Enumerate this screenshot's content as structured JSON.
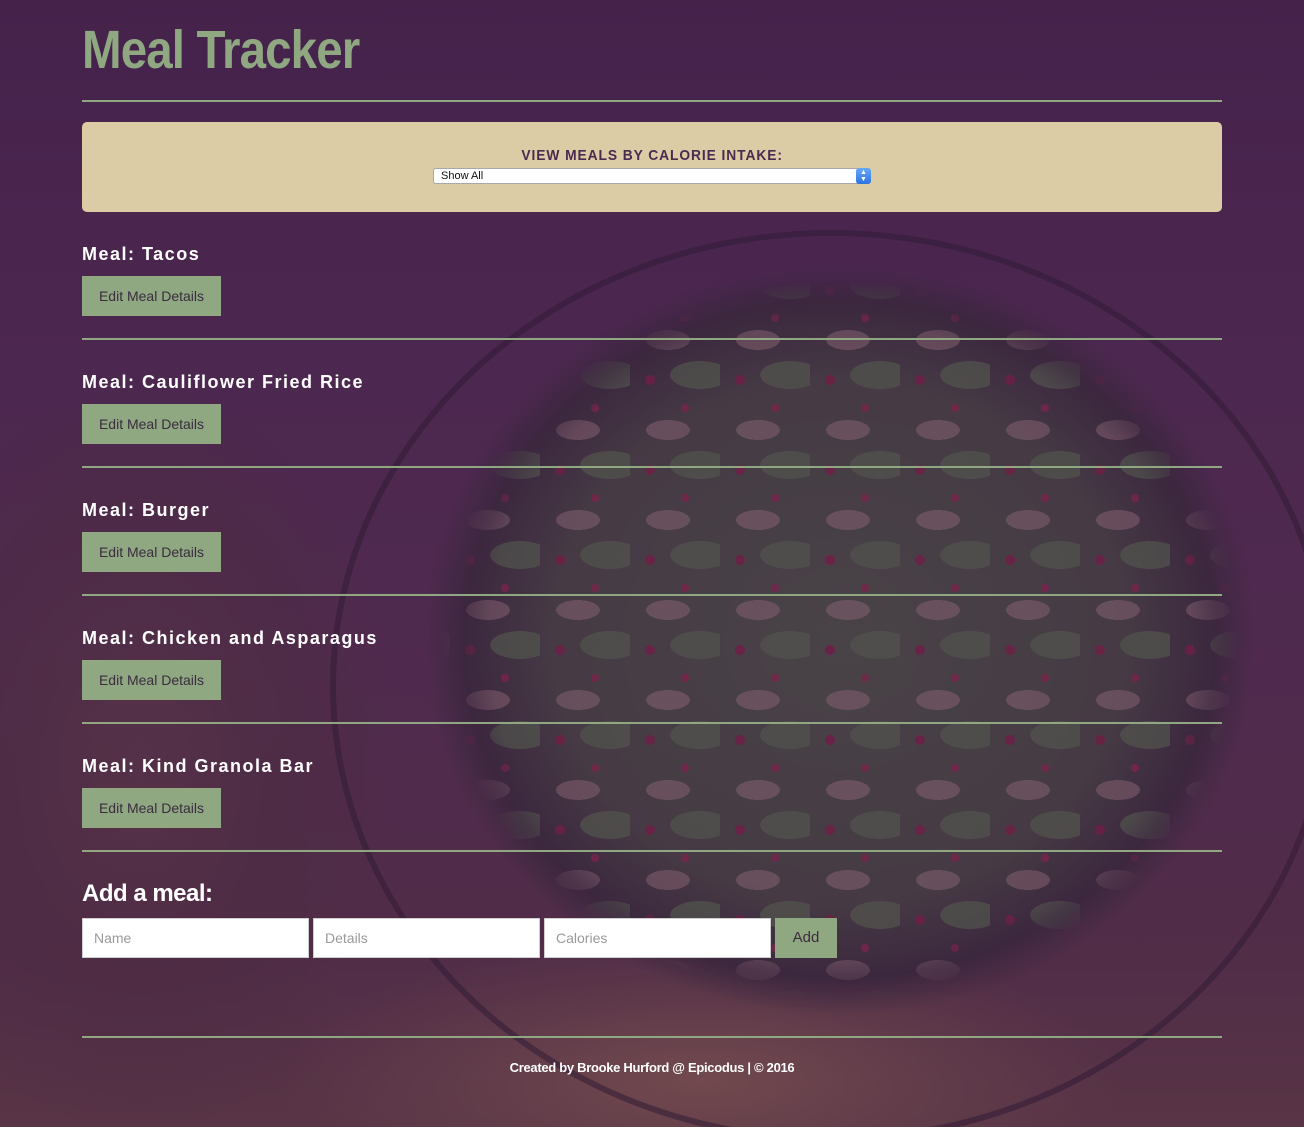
{
  "app": {
    "title": "Meal Tracker"
  },
  "filter": {
    "label": "VIEW MEALS BY CALORIE INTAKE:",
    "selected": "Show All"
  },
  "meals": [
    {
      "name": "Meal: Tacos",
      "button": "Edit Meal Details"
    },
    {
      "name": "Meal: Cauliflower Fried Rice",
      "button": "Edit Meal Details"
    },
    {
      "name": "Meal: Burger",
      "button": "Edit Meal Details"
    },
    {
      "name": "Meal: Chicken and Asparagus",
      "button": "Edit Meal Details"
    },
    {
      "name": "Meal: Kind Granola Bar",
      "button": "Edit Meal Details"
    }
  ],
  "add_meal": {
    "title": "Add a meal:",
    "name_placeholder": "Name",
    "details_placeholder": "Details",
    "calories_placeholder": "Calories",
    "button": "Add"
  },
  "footer": {
    "text": "Created by Brooke Hurford @ Epicodus | © 2016"
  },
  "colors": {
    "background": "#4a2a4f",
    "accent": "#8fa882",
    "panel": "#dccca5"
  }
}
